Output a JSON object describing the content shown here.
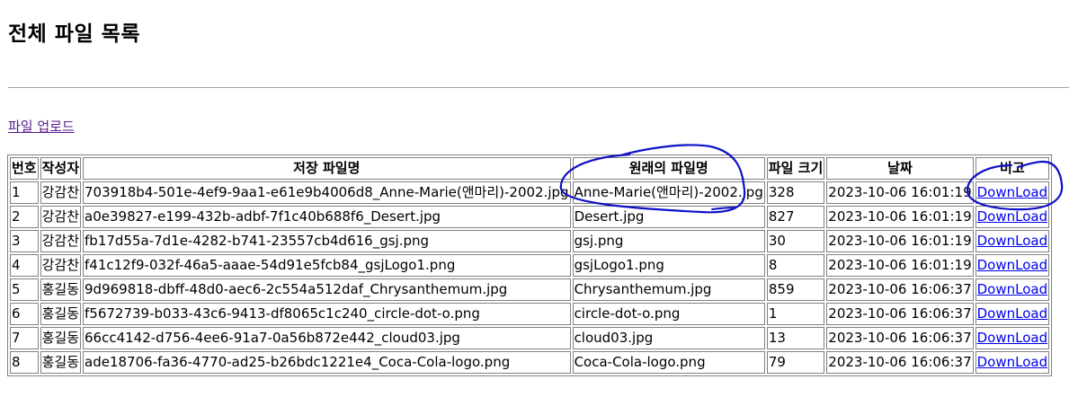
{
  "page": {
    "title": "전체 파일 목록",
    "upload_link": "파일 업로드"
  },
  "table": {
    "headers": [
      "번호",
      "작성자",
      "저장 파일명",
      "원래의 파일명",
      "파일 크기",
      "날짜",
      "비고"
    ],
    "rows": [
      [
        "1",
        "강감찬",
        "703918b4-501e-4ef9-9aa1-e61e9b4006d8_Anne-Marie(앤마리)-2002.jpg",
        "Anne-Marie(앤마리)-2002.jpg",
        "328",
        "2023-10-06 16:01:19",
        "DownLoad"
      ],
      [
        "2",
        "강감찬",
        "a0e39827-e199-432b-adbf-7f1c40b688f6_Desert.jpg",
        "Desert.jpg",
        "827",
        "2023-10-06 16:01:19",
        "DownLoad"
      ],
      [
        "3",
        "강감찬",
        "fb17d55a-7d1e-4282-b741-23557cb4d616_gsj.png",
        "gsj.png",
        "30",
        "2023-10-06 16:01:19",
        "DownLoad"
      ],
      [
        "4",
        "강감찬",
        "f41c12f9-032f-46a5-aaae-54d91e5fcb84_gsjLogo1.png",
        "gsjLogo1.png",
        "8",
        "2023-10-06 16:01:19",
        "DownLoad"
      ],
      [
        "5",
        "홍길동",
        "9d969818-dbff-48d0-aec6-2c554a512daf_Chrysanthemum.jpg",
        "Chrysanthemum.jpg",
        "859",
        "2023-10-06 16:06:37",
        "DownLoad"
      ],
      [
        "6",
        "홍길동",
        "f5672739-b033-43c6-9413-df8065c1c240_circle-dot-o.png",
        "circle-dot-o.png",
        "1",
        "2023-10-06 16:06:37",
        "DownLoad"
      ],
      [
        "7",
        "홍길동",
        "66cc4142-d756-4ee6-91a7-0a56b872e442_cloud03.jpg",
        "cloud03.jpg",
        "13",
        "2023-10-06 16:06:37",
        "DownLoad"
      ],
      [
        "8",
        "홍길동",
        "ade18706-fa36-4770-ad25-b26bdc1221e4_Coca-Cola-logo.png",
        "Coca-Cola-logo.png",
        "79",
        "2023-10-06 16:06:37",
        "DownLoad"
      ]
    ]
  },
  "colors": {
    "link": "#0000ee",
    "visited_link": "#551a8b",
    "annotation": "#1010c8",
    "border": "#808080"
  }
}
